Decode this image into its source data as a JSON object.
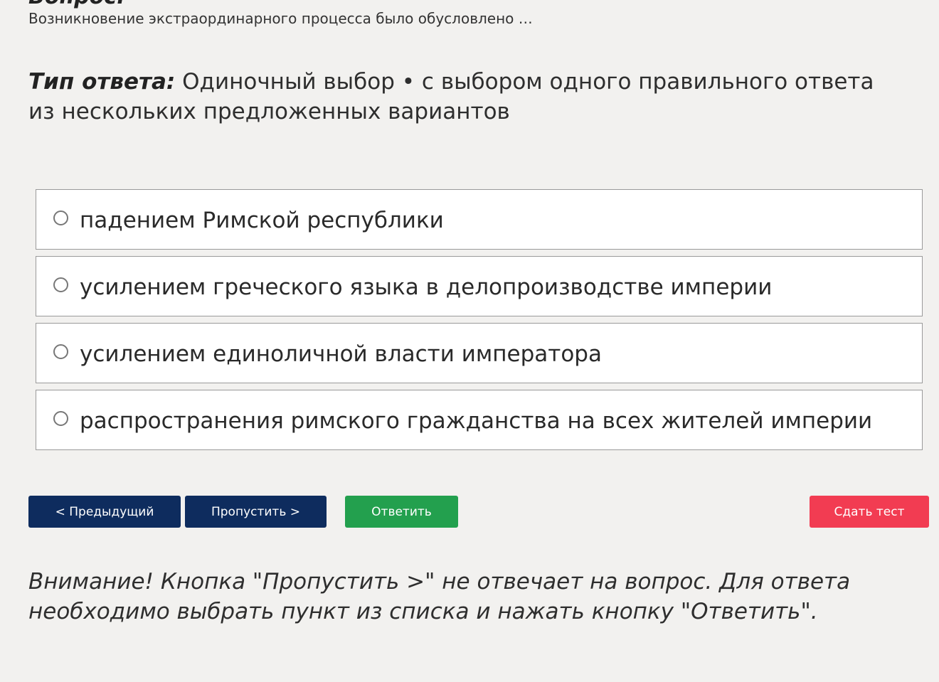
{
  "question": {
    "heading": "Вопрос:",
    "text": "Возникновение экстраординарного процесса было обусловлено …"
  },
  "answer_type": {
    "label": "Тип ответа:",
    "value": "Одиночный выбор • с выбором одного правильного ответа из нескольких предложенных вариантов"
  },
  "options": [
    {
      "label": "падением Римской республики",
      "selected": false
    },
    {
      "label": "усилением греческого языка в делопроизводстве империи",
      "selected": false
    },
    {
      "label": "усилением единоличной власти императора",
      "selected": false
    },
    {
      "label": "распространения римского гражданства на всех жителей империи",
      "selected": false
    }
  ],
  "buttons": {
    "prev": "< Предыдущий",
    "skip": "Пропустить >",
    "answer": "Ответить",
    "submit": "Сдать тест"
  },
  "notice": "Внимание! Кнопка \"Пропустить >\" не отвечает на вопрос. Для ответа необходимо выбрать пункт из списка и нажать кнопку \"Ответить\".",
  "colors": {
    "background": "#f2f1ef",
    "nav_button": "#0e2c5e",
    "answer_button": "#23a04e",
    "submit_button": "#f23c52"
  }
}
